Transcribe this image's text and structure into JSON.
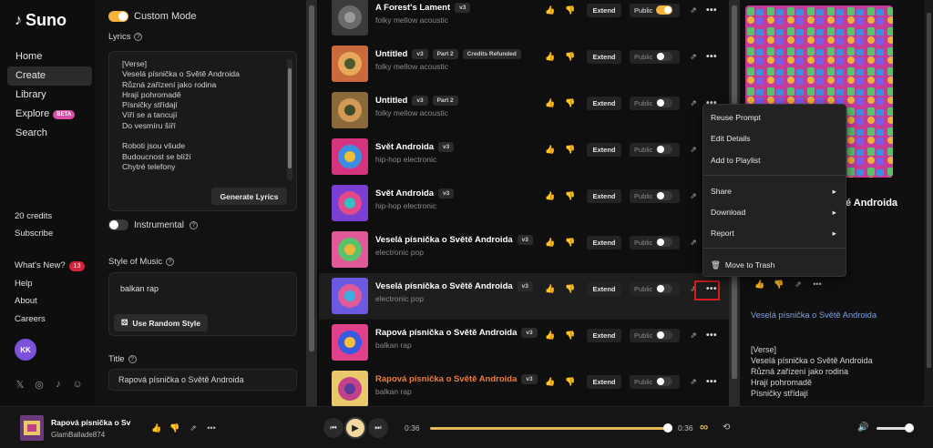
{
  "brand": {
    "name": "Suno"
  },
  "nav": [
    {
      "label": "Home",
      "active": false
    },
    {
      "label": "Create",
      "active": true
    },
    {
      "label": "Library",
      "active": false
    },
    {
      "label": "Explore",
      "active": false,
      "badge": "BETA"
    },
    {
      "label": "Search",
      "active": false
    }
  ],
  "account": {
    "credits": "20 credits",
    "subscribe": "Subscribe",
    "whats_new": "What's New?",
    "whats_new_count": "13",
    "help": "Help",
    "about": "About",
    "careers": "Careers",
    "avatar_initials": "KK"
  },
  "socials": [
    "x-icon",
    "instagram-icon",
    "tiktok-icon",
    "discord-icon"
  ],
  "create": {
    "custom_mode_label": "Custom Mode",
    "custom_mode_on": true,
    "lyrics_label": "Lyrics",
    "lyrics": "[Verse]\nVeselá písnička o Světě Androida\nRůzná zařízení jako rodina\nHrají pohromadě\nPísničky střídají\nVíří se a tancují\nDo vesmíru šíří\n\nRoboti jsou všude\nBudoucnost se blíží\nChytré telefony",
    "generate_lyrics": "Generate Lyrics",
    "instrumental_label": "Instrumental",
    "instrumental_on": false,
    "style_label": "Style of Music",
    "style_value": "balkan rap",
    "random_style": "Use Random Style",
    "title_label": "Title",
    "title_value": "Rapová písnička o Světě Androida"
  },
  "songs": [
    {
      "title": "A Forest's Lament",
      "version": "v3",
      "genre": "folky mellow acoustic",
      "chips": [],
      "public": true,
      "cover": "forest"
    },
    {
      "title": "Untitled",
      "version": "v3",
      "genre": "folky mellow acoustic",
      "chips": [
        "Part 2",
        "Credits Refunded"
      ],
      "public": false,
      "cover": "meadow"
    },
    {
      "title": "Untitled",
      "version": "v3",
      "genre": "folky mellow acoustic",
      "chips": [
        "Part 2"
      ],
      "public": false,
      "cover": "meadow2"
    },
    {
      "title": "Svět Androida",
      "version": "v3",
      "genre": "hip-hop electronic",
      "chips": [],
      "public": false,
      "cover": "psy1"
    },
    {
      "title": "Svět Androida",
      "version": "v3",
      "genre": "hip-hop electronic",
      "chips": [],
      "public": false,
      "cover": "psy2"
    },
    {
      "title": "Veselá písnička o Světě Androida",
      "version": "v3",
      "genre": "electronic pop",
      "chips": [],
      "public": false,
      "cover": "pop1"
    },
    {
      "title": "Veselá písnička o Světě Androida",
      "version": "v3",
      "genre": "electronic pop",
      "chips": [],
      "public": false,
      "cover": "pop2",
      "selected": true
    },
    {
      "title": "Rapová písnička o Světě Androida",
      "version": "v3",
      "genre": "balkan rap",
      "chips": [],
      "public": false,
      "cover": "rap1"
    },
    {
      "title": "Rapová písnička o Světě Androida",
      "version": "v3",
      "genre": "balkan rap",
      "chips": [],
      "public": false,
      "cover": "rap2",
      "playing": true
    }
  ],
  "song_actions": {
    "extend": "Extend",
    "public": "Public"
  },
  "context_menu": {
    "items": [
      {
        "label": "Reuse Prompt",
        "submenu": false
      },
      {
        "label": "Edit Details",
        "submenu": false
      },
      {
        "label": "Add to Playlist",
        "submenu": false
      },
      {
        "label": "Share",
        "submenu": true
      },
      {
        "label": "Download",
        "submenu": true
      },
      {
        "label": "Report",
        "submenu": true
      },
      {
        "label": "Move to Trash",
        "submenu": false
      }
    ]
  },
  "detail": {
    "title": "é Androida",
    "link": "Veselá písnička o Světě Androida",
    "lyrics": "[Verse]\nVeselá písnička o Světě Androida\nRůzná zařízení jako rodina\nHrají pohromadě\nPísničky střídají"
  },
  "player": {
    "title": "Rapová písnička o Sv",
    "artist": "GlamBallade874",
    "time_current": "0:36",
    "time_total": "0:36",
    "progress": 1.0,
    "volume": 0.9
  },
  "colors": {
    "accent": "#f4b23a",
    "highlight": "#d81e1e",
    "orange_title": "#f07b3b",
    "link": "#7aa0dd"
  }
}
